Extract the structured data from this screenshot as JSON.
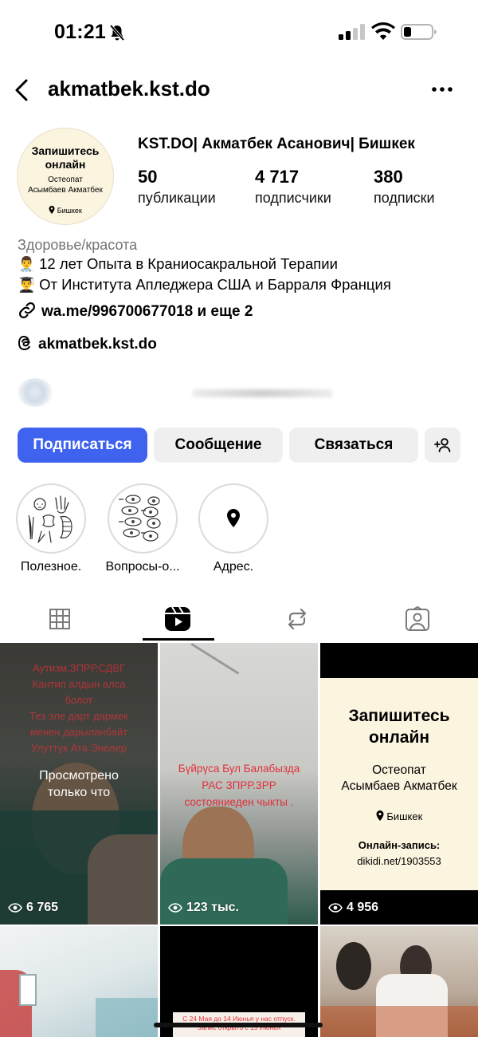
{
  "status_bar": {
    "time": "01:21",
    "icons": [
      "bell-slash-icon",
      "signal-icon",
      "wifi-icon",
      "battery-icon"
    ]
  },
  "header": {
    "username": "akmatbek.kst.do",
    "back_icon": "chevron-left-icon",
    "more_icon": "more-horizontal-icon"
  },
  "profile": {
    "avatar": {
      "line1": "Запишитесь",
      "line2": "онлайн",
      "line3": "Остеопат",
      "line4": "Асымбаев Акматбек",
      "line5": "Бишкек"
    },
    "full_name": "KST.DO| Акматбек Асанович| Бишкек",
    "stats": [
      {
        "value": "50",
        "label": "публикации"
      },
      {
        "value": "4 717",
        "label": "подписчики"
      },
      {
        "value": "380",
        "label": "подписки"
      }
    ],
    "category": "Здоровье/красота",
    "bio": [
      {
        "emoji": "👨‍⚕️",
        "text": "12 лет Опыта в Краниосакральной Терапии"
      },
      {
        "emoji": "👨‍🎓",
        "text": "От Института Апледжера США и Барраля Франция"
      }
    ],
    "link": "wa.me/996700677018 и еще 2",
    "threads": "akmatbek.kst.do"
  },
  "buttons": {
    "follow": "Подписаться",
    "message": "Сообщение",
    "contact": "Связаться",
    "add_person_icon": "add-person-icon"
  },
  "highlights": [
    {
      "label": "Полезное.",
      "icon": "skeleton-illustration"
    },
    {
      "label": "Вопросы-о...",
      "icon": "spine-illustration"
    },
    {
      "label": "Адрес.",
      "icon": "location-pin-icon"
    }
  ],
  "tabs": [
    {
      "name": "grid",
      "icon": "grid-icon",
      "active": false
    },
    {
      "name": "reels",
      "icon": "reels-icon",
      "active": true
    },
    {
      "name": "reposts",
      "icon": "repost-icon",
      "active": false
    },
    {
      "name": "tagged",
      "icon": "tagged-icon",
      "active": false
    }
  ],
  "reels": [
    {
      "views": "6 765",
      "overlay": "Просмотрено\nтолько что",
      "caption": "Аутизм,ЗПРР,СДВГ\nКантип алдын алса\nболот\nТез эле дарт дармек\nменен дарыланбайт\nУлуттук Ата Энелер"
    },
    {
      "views": "123 тыс.",
      "caption": "Бүйрүса Бул Балабызда\nРАС ЗПРР.ЗРР\nсостояниеден чыкты ."
    },
    {
      "views": "4 956",
      "title": "Запишитесь онлайн",
      "subtitle": "Остеопат\nАсымбаев Акматбек",
      "city": "Бишкек",
      "booking_label": "Онлайн-запись:",
      "booking_url": "dikidi.net/1903553"
    },
    {
      "views": ""
    },
    {
      "views": "",
      "caption": "С 24 Мая до 14 Июнья у нас отпуск.\nЗапис открыто с 15 Июнья"
    },
    {
      "views": ""
    }
  ],
  "colors": {
    "accent": "#3f63ef",
    "button_bg": "#efefef",
    "category_text": "#737373",
    "reel_caption_red": "#e0303a"
  }
}
